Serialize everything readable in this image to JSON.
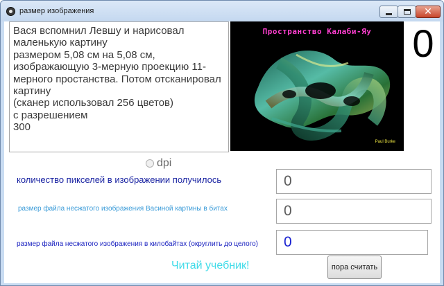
{
  "window": {
    "title": "размер изображения",
    "icon": "app-icon",
    "controls": [
      "minimize-icon",
      "maximize-icon",
      "close-icon"
    ]
  },
  "story": {
    "text": "Вася вспомнил Левшу и нарисовал маленькую картину\nразмером 5,08 см на 5,08 см,\n изображающую 3-мерную проекцию 11-мерного простанства.  Потом отсканировал картину\n(сканер использовал 256 цветов)\n с разрешением\n300"
  },
  "picture": {
    "title": "Пространство Калаби-Яу",
    "credit": "Paul Burke"
  },
  "counter": "0",
  "unit_radio": {
    "label": "dpi",
    "checked": false
  },
  "questions": [
    {
      "label": "количество пикселей в изображении получилось",
      "value": "0"
    },
    {
      "label": "размер файла несжатого изображения Васиной картины в битах",
      "value": "0"
    },
    {
      "label": "размер файла несжатого изображения в килобайтах (округлить до целого)",
      "value": "0"
    }
  ],
  "footer": {
    "hint": "Читай учебник!",
    "button_label": "пора считать"
  },
  "colors": {
    "question1": "#151fa0",
    "question2": "#3a9bd8",
    "question3": "#1a22c0",
    "hint": "#3fdbe8",
    "picture_title": "#ff3fd0"
  }
}
